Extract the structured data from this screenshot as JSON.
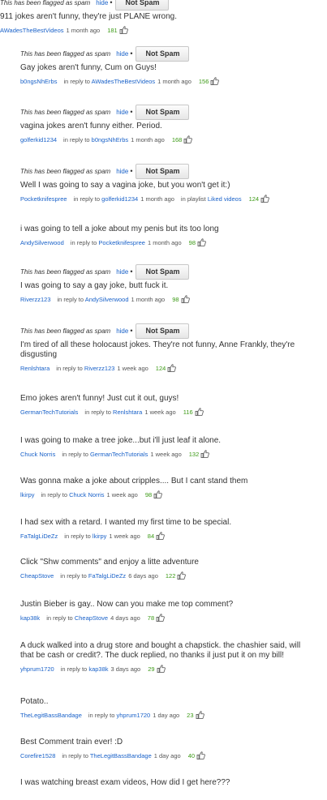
{
  "labels": {
    "flagged": "This has been flagged as spam",
    "hide": "hide",
    "bullet": "•",
    "not_spam": "Not Spam",
    "in_reply_to": "in reply to",
    "in_playlist": "in playlist"
  },
  "comments": [
    {
      "flagged": true,
      "reply": false,
      "text": "911 jokes aren't funny, they're just PLANE wrong.",
      "user": "AWadesTheBestVideos",
      "parent": "",
      "time": "1 month ago",
      "playlist": "",
      "likes": "181"
    },
    {
      "flagged": true,
      "reply": true,
      "text": "Gay jokes aren't funny, Cum on Guys!",
      "user": "b0ngsNhErbs",
      "parent": "AWadesTheBestVideos",
      "time": "1 month ago",
      "playlist": "",
      "likes": "156"
    },
    {
      "flagged": true,
      "reply": true,
      "text": "vagina jokes aren't funny either. Period.",
      "user": "golferkid1234",
      "parent": "b0ngsNhErbs",
      "time": "1 month ago",
      "playlist": "",
      "likes": "168"
    },
    {
      "flagged": true,
      "reply": true,
      "text": "Well I was going to say a vagina joke, but you won't get it:)",
      "user": "Pocketknifespree",
      "parent": "golferkid1234",
      "time": "1 month ago",
      "playlist": "Liked videos",
      "likes": "124"
    },
    {
      "flagged": false,
      "reply": true,
      "text": "i was going to tell a joke about my penis but its too long",
      "user": "AndySilverwood",
      "parent": "Pocketknifespree",
      "time": "1 month ago",
      "playlist": "",
      "likes": "98"
    },
    {
      "flagged": true,
      "reply": true,
      "text": "I was going to say a gay joke, butt fuck it.",
      "user": "Riverzz123",
      "parent": "AndySilverwood",
      "time": "1 month ago",
      "playlist": "",
      "likes": "98"
    },
    {
      "flagged": true,
      "reply": true,
      "text": "I'm tired of all these holocaust jokes. They're not funny, Anne Frankly, they're\ndisgusting",
      "user": "Renlshtara",
      "parent": "Riverzz123",
      "time": "1 week ago",
      "playlist": "",
      "likes": "124"
    },
    {
      "flagged": false,
      "reply": true,
      "text": "Emo jokes aren't funny! Just cut it out, guys!",
      "user": "GermanTechTutorials",
      "parent": "Renlshtara",
      "time": "1 week ago",
      "playlist": "",
      "likes": "116"
    },
    {
      "flagged": false,
      "reply": true,
      "text": "I was going to make a tree joke...but i'll just leaf it alone.",
      "user": "Chuck Norris",
      "parent": "GermanTechTutorials",
      "time": "1 week ago",
      "playlist": "",
      "likes": "132"
    },
    {
      "flagged": false,
      "reply": true,
      "text": "Was gonna make a joke about cripples.... But I cant stand them",
      "user": "lkirpy",
      "parent": "Chuck Norris",
      "time": "1 week ago",
      "playlist": "",
      "likes": "98"
    },
    {
      "flagged": false,
      "reply": true,
      "text": "I had sex with a retard. I wanted my first time to be special.",
      "user": "FaTalgLiDeZz",
      "parent": "lkirpy",
      "time": "1 week ago",
      "playlist": "",
      "likes": "84"
    },
    {
      "flagged": false,
      "reply": true,
      "text": "Click \"Shw comments\" and enjoy a litte adventure",
      "user": "CheapStove",
      "parent": "FaTalgLiDeZz",
      "time": "6 days ago",
      "playlist": "",
      "likes": "122"
    },
    {
      "flagged": false,
      "reply": true,
      "text": "Justin Bieber is gay.. Now can you make me top comment?",
      "user": "kap38k",
      "parent": "CheapStove",
      "time": "4 days ago",
      "playlist": "",
      "likes": "78"
    },
    {
      "flagged": false,
      "reply": true,
      "text": "A duck walked into a drug store and bought a chapstick. the chashier said, will\nthat be cash or credit?. The duck replied, no thanks il just put it on my bill!",
      "user": "yhprum1720",
      "parent": "kap38k",
      "time": "3 days ago",
      "playlist": "",
      "likes": "29"
    },
    {
      "flagged": false,
      "reply": true,
      "text": "Potato..",
      "user": "TheLegitBassBandage",
      "parent": "yhprum1720",
      "time": "1 day ago",
      "playlist": "",
      "likes": "23"
    },
    {
      "flagged": false,
      "reply": true,
      "text": "Best Comment train ever! :D",
      "user": "Corefire1528",
      "parent": "TheLegitBassBandage",
      "time": "1 day ago",
      "playlist": "",
      "likes": "40"
    },
    {
      "flagged": false,
      "reply": true,
      "text": "I was watching breast exam videos, How did I get here???",
      "user": "",
      "parent": "",
      "time": "",
      "playlist": "",
      "likes": ""
    }
  ]
}
